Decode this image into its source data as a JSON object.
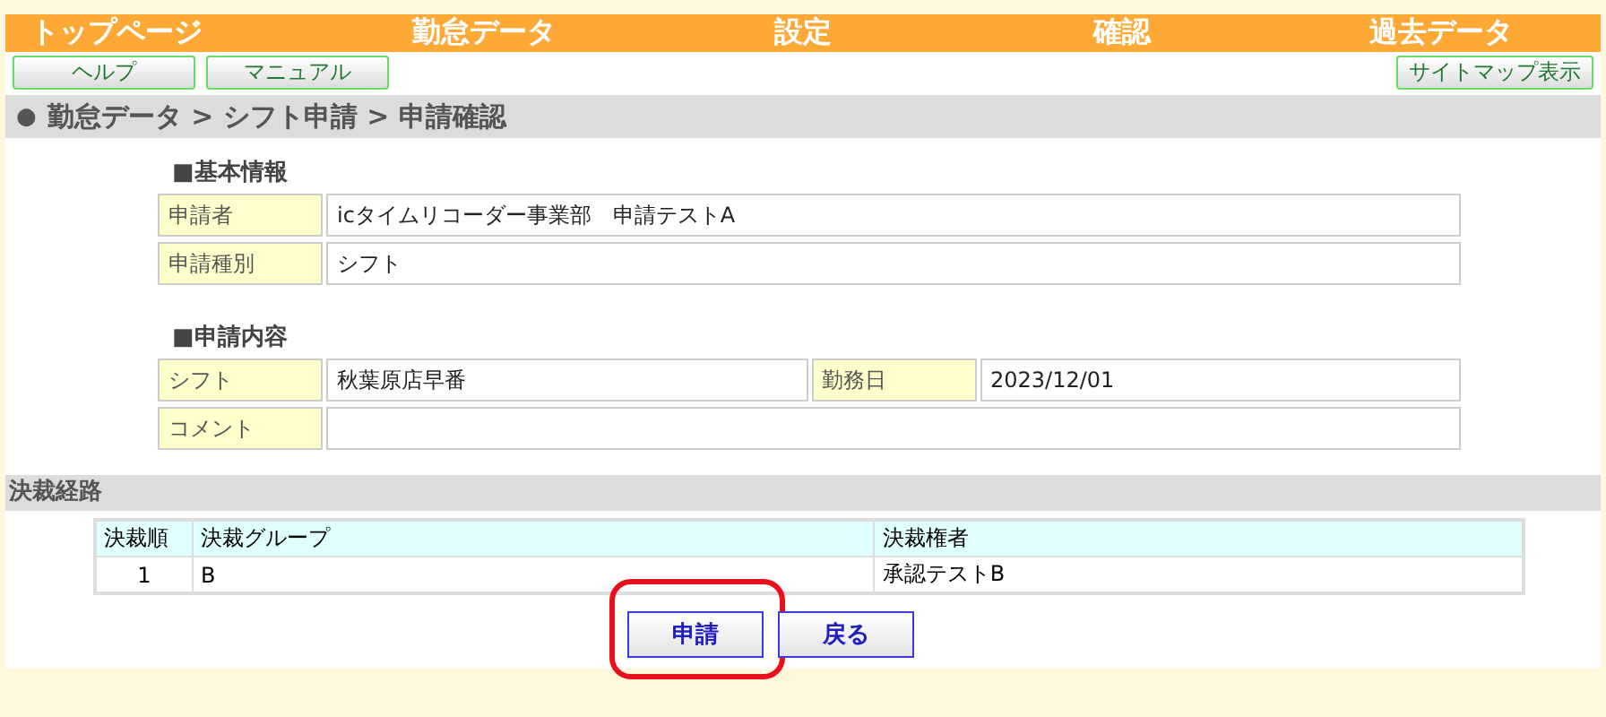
{
  "nav": [
    {
      "label": "トップページ"
    },
    {
      "label": "勤怠データ"
    },
    {
      "label": "設定"
    },
    {
      "label": "確認"
    },
    {
      "label": "過去データ"
    }
  ],
  "toolbar": {
    "left_buttons": [
      "ヘルプ",
      "マニュアル"
    ],
    "right_button": "サイトマップ表示"
  },
  "breadcrumb": {
    "bullet": "●",
    "path": "勤怠データ > シフト申請 > 申請確認"
  },
  "sections": [
    {
      "title": "■基本情報",
      "rows": [
        [
          {
            "label": "申請者",
            "value": "icタイムリコーダー事業部　申請テストA"
          }
        ],
        [
          {
            "label": "申請種別",
            "value": "シフト"
          }
        ]
      ]
    },
    {
      "title": "■申請内容",
      "rows": [
        [
          {
            "label": "シフト",
            "value": "秋葉原店早番"
          },
          {
            "label": "勤務日",
            "value": "2023/12/01"
          }
        ],
        [
          {
            "label": "コメント"
          }
        ]
      ]
    }
  ],
  "route": {
    "title": "決裁経路",
    "columns": [
      "決裁順",
      "決裁グループ",
      "決裁権者"
    ],
    "rows": [
      [
        "1",
        "B",
        "承認テストB"
      ]
    ]
  },
  "actions": [
    {
      "label": "申請",
      "highlighted": true
    },
    {
      "label": "戻る",
      "highlighted": false
    }
  ]
}
